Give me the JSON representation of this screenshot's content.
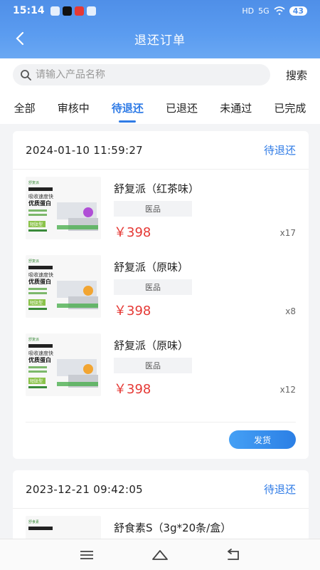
{
  "status_bar": {
    "time": "15:14",
    "battery": "43",
    "signal_label": "5G",
    "hd_label": "HD"
  },
  "header": {
    "title": "退还订单"
  },
  "search": {
    "placeholder": "请输入产品名称",
    "button_label": "搜索"
  },
  "tabs": [
    {
      "label": "全部",
      "active": false
    },
    {
      "label": "审核中",
      "active": false
    },
    {
      "label": "待退还",
      "active": true
    },
    {
      "label": "已退还",
      "active": false
    },
    {
      "label": "未通过",
      "active": false
    },
    {
      "label": "已完成",
      "active": false
    }
  ],
  "orders": [
    {
      "date": "2024-01-10 11:59:27",
      "status": "待退还",
      "items": [
        {
          "name": "舒复派（红茶味）",
          "tag": "医品",
          "price": "￥398",
          "qty": "x17",
          "accent": "#b04fd6"
        },
        {
          "name": "舒复派（原味）",
          "tag": "医品",
          "price": "￥398",
          "qty": "x8",
          "accent": "#f2a532"
        },
        {
          "name": "舒复派（原味）",
          "tag": "医品",
          "price": "￥398",
          "qty": "x12",
          "accent": "#f2a532"
        }
      ],
      "action_label": "发货"
    },
    {
      "date": "2023-12-21 09:42:05",
      "status": "待退还",
      "items": [
        {
          "name": "舒食素S（3g*20条/盒）"
        }
      ]
    }
  ],
  "product_image_text": {
    "brand": "舒复派",
    "line1": "吸收速度快",
    "line2": "优质蛋白",
    "badge": "短肽型"
  },
  "colors": {
    "accent": "#2f7be6",
    "price": "#e53935",
    "header": "#5b9cf0"
  },
  "icons": {
    "back": "chevron-left-icon",
    "search": "search-icon",
    "menu": "menu-icon",
    "home": "home-icon",
    "return": "return-icon"
  }
}
